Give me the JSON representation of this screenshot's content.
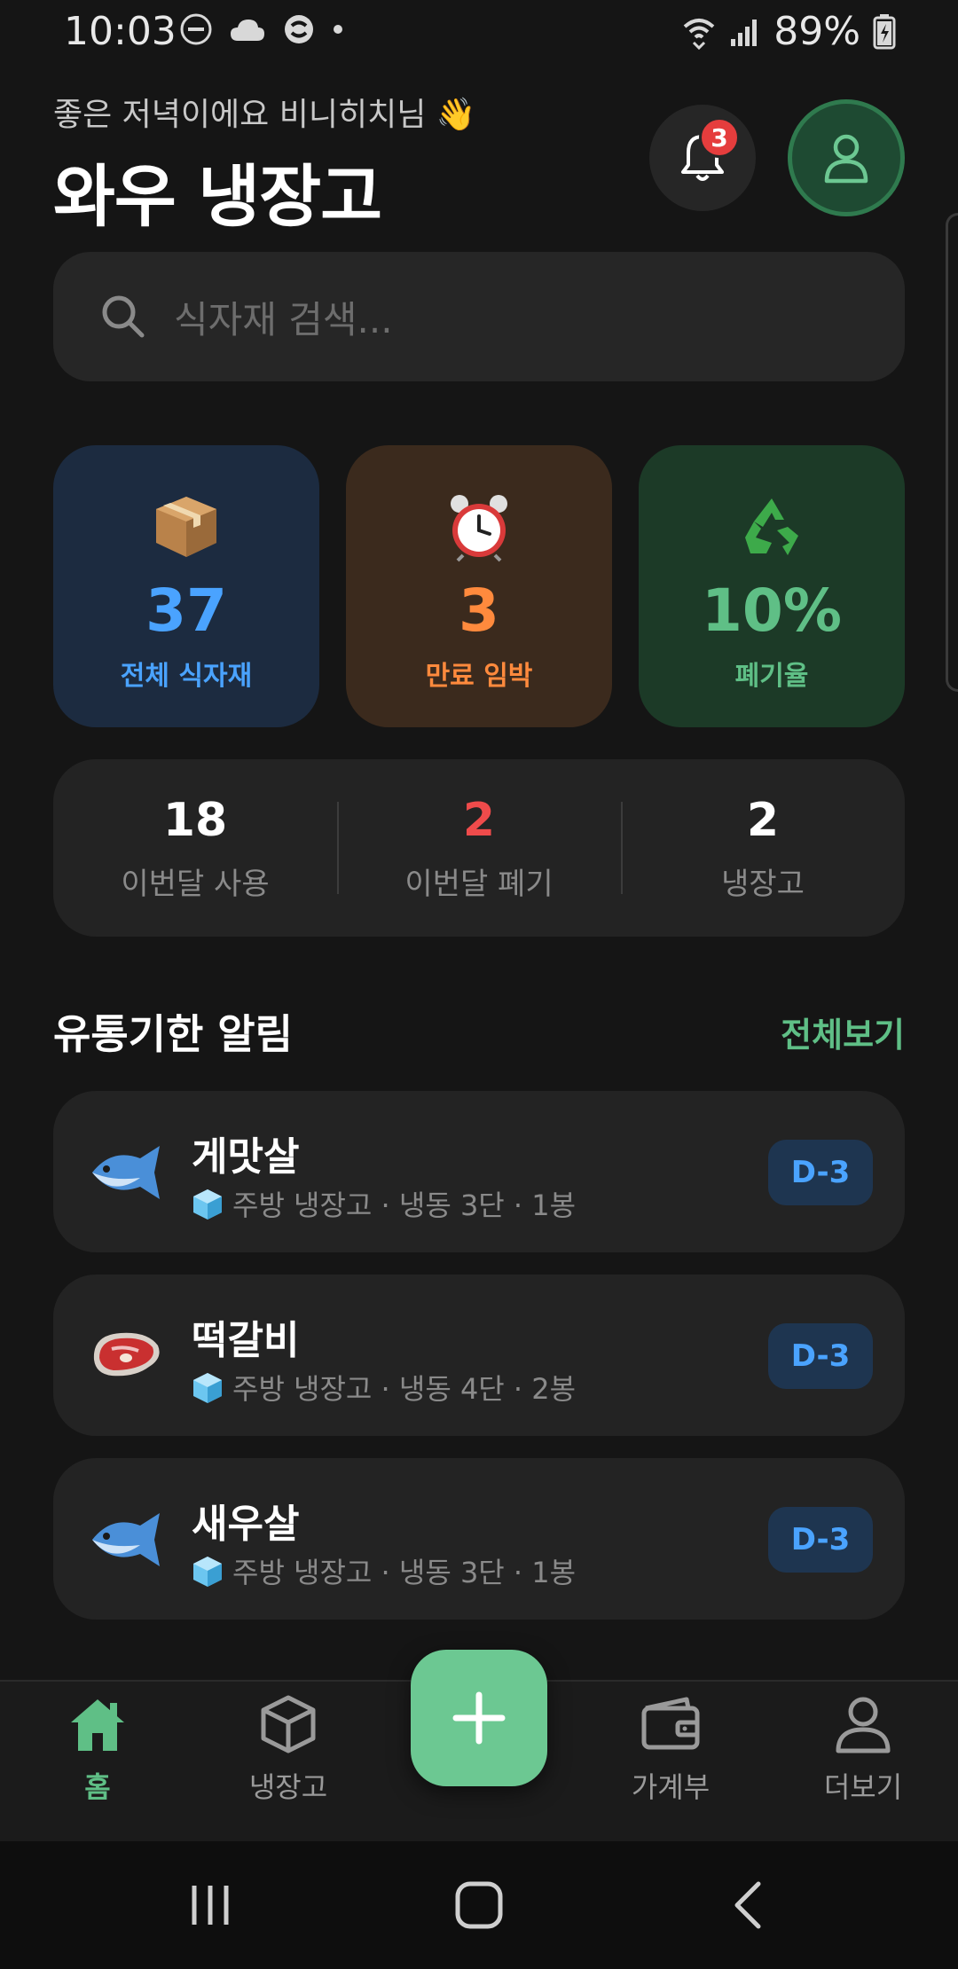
{
  "status_bar": {
    "time": "10:03",
    "battery": "89%"
  },
  "header": {
    "greeting": "좋은 저녁이에요 비니히치님 👋",
    "title": "와우 냉장고",
    "notification_count": "3"
  },
  "search": {
    "placeholder": "식자재 검색..."
  },
  "summary": [
    {
      "icon": "package-icon",
      "value": "37",
      "label": "전체 식자재",
      "bg": "#1c2b40",
      "color": "#4aa3ff"
    },
    {
      "icon": "alarm-clock-icon",
      "value": "3",
      "label": "만료 임박",
      "bg": "#3b2a1d",
      "color": "#ff8a3d"
    },
    {
      "icon": "recycle-icon",
      "value": "10%",
      "label": "폐기율",
      "bg": "#1c3a27",
      "color": "#5fbf86"
    }
  ],
  "monthly": [
    {
      "value": "18",
      "label": "이번달 사용",
      "color": "#ffffff"
    },
    {
      "value": "2",
      "label": "이번달 폐기",
      "color": "#ef4b4b"
    },
    {
      "value": "2",
      "label": "냉장고",
      "color": "#ffffff"
    }
  ],
  "alerts": {
    "title": "유통기한 알림",
    "view_all": "전체보기",
    "items": [
      {
        "icon": "fish-icon",
        "name": "게맛살",
        "location": "주방 냉장고 · 냉동 3단 · 1봉",
        "dday": "D-3"
      },
      {
        "icon": "meat-icon",
        "name": "떡갈비",
        "location": "주방 냉장고 · 냉동 4단 · 2봉",
        "dday": "D-3"
      },
      {
        "icon": "fish-icon",
        "name": "새우살",
        "location": "주방 냉장고 · 냉동 3단 · 1봉",
        "dday": "D-3"
      }
    ]
  },
  "bottom_nav": {
    "home": "홈",
    "fridge": "냉장고",
    "ledger": "가계부",
    "more": "더보기",
    "active": "home"
  },
  "colors": {
    "accent": "#6cc892",
    "background": "#151515",
    "card": "#232323"
  }
}
